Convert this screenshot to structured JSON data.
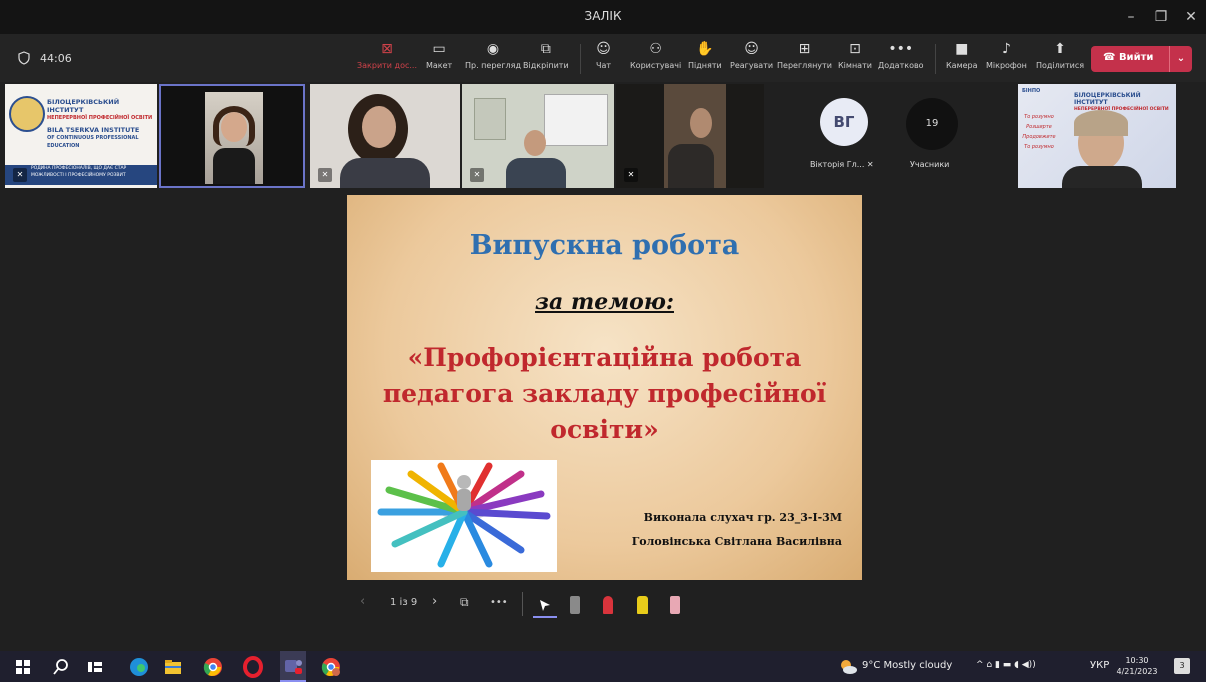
{
  "window": {
    "title": "ЗАЛІК",
    "controls": [
      "–",
      "❐",
      "✕"
    ]
  },
  "meeting": {
    "timer": "44:06",
    "toolbar": [
      {
        "label": "Закрити дос...",
        "icon": "close-share-icon",
        "glyph": "⊠",
        "color": "#d0424a"
      },
      {
        "label": "Макет",
        "icon": "layout-icon",
        "glyph": "▭"
      },
      {
        "label": "Пр. перегляд",
        "icon": "eye-icon",
        "glyph": "◉"
      },
      {
        "label": "Відкріпити",
        "icon": "popout-icon",
        "glyph": "⧉"
      },
      {
        "label": "Чат",
        "icon": "chat-icon",
        "glyph": "☺"
      },
      {
        "label": "Користувачі",
        "icon": "people-icon",
        "glyph": "⚇"
      },
      {
        "label": "Підняти",
        "icon": "raise-hand-icon",
        "glyph": "✋"
      },
      {
        "label": "Реагувати",
        "icon": "react-icon",
        "glyph": "☺"
      },
      {
        "label": "Переглянути",
        "icon": "view-icon",
        "glyph": "⊞"
      },
      {
        "label": "Кімнати",
        "icon": "rooms-icon",
        "glyph": "⊡"
      },
      {
        "label": "Додатково",
        "icon": "more-icon",
        "glyph": "•••"
      },
      {
        "label": "Камера",
        "icon": "camera-icon",
        "glyph": "■"
      },
      {
        "label": "Мікрофон",
        "icon": "microphone-icon",
        "glyph": "♪"
      },
      {
        "label": "Поділитися",
        "icon": "share-icon",
        "glyph": "⬆"
      }
    ],
    "leave_label": "Вийти",
    "leave_color": "#c4314b"
  },
  "participants": {
    "initials": "ВГ",
    "initials_name": "Вікторія Гл...",
    "count": "19",
    "count_label": "Учасники"
  },
  "tile_banner": {
    "line1": "БІЛОЦЕРКІВСЬКИЙ ІНСТИТУТ",
    "line2": "НЕПЕРЕРВНОЇ ПРОФЕСІЙНОЇ ОСВІТИ",
    "line3": "BILA TSERKVA INSTITUTE",
    "line4": "OF CONTINUOUS PROFESSIONAL",
    "line5": "EDUCATION",
    "line6": "РОДИНА ПРОФЕСІОНАЛІВ, ЩО ДАЄ СТАР",
    "line7": "МОЖЛИВОСТІ І ПРОФЕСІЙНОМУ РОЗВИТ"
  },
  "tile_right": {
    "abbr": "БІНПО",
    "line1": "БІЛОЦЕРКІВСЬКИЙ ІНСТИТУТ",
    "line2": "НЕПЕРЕРВНОЇ ПРОФЕСІЙНОЇ ОСВІТИ",
    "side1": "То розумно",
    "side2": "Розширте",
    "side3": "Продовжите",
    "side4": "То розумно"
  },
  "slide": {
    "title": "Випускна робота",
    "subtitle": "за темою:",
    "topic_line1": "«Профорієнтаційна робота",
    "topic_line2": "педагога закладу професійної",
    "topic_line3": "освіти»",
    "author_line1": "Виконала слухач гр. 23_3-І-3М",
    "author_line2": "Головінська Світлана Василівна"
  },
  "slide_nav": {
    "page": "1 із 9"
  },
  "taskbar": {
    "weather": "9°C  Mostly cloudy",
    "language": "УКР",
    "time": "10:30",
    "date": "4/21/2023",
    "notifications": "3"
  }
}
